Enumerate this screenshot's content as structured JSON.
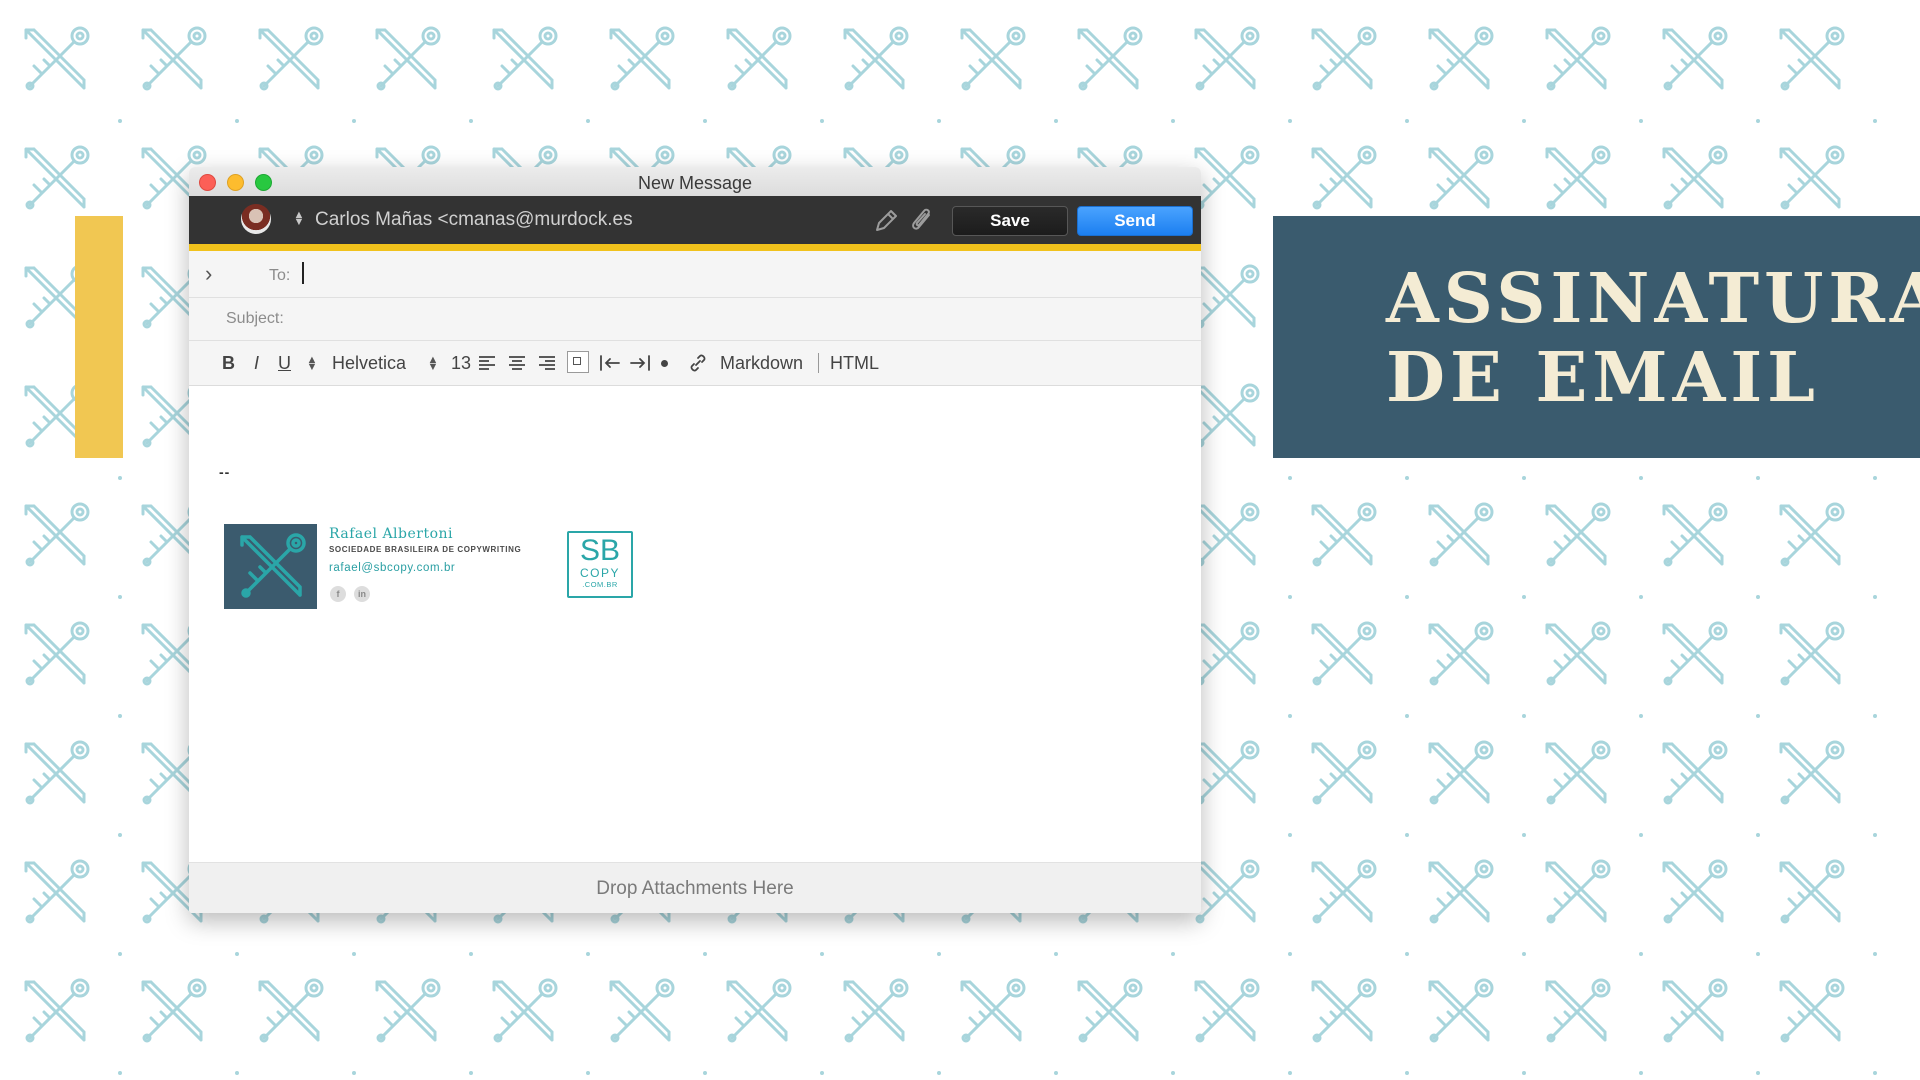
{
  "slide": {
    "title_line1": "ASSINATURA",
    "title_line2": "DE EMAIL",
    "colors": {
      "panel": "#3a5b6e",
      "title_text": "#f4ecd4",
      "accent_bar": "#f1c752",
      "pattern": "#a8d5dc"
    },
    "pattern_icon": "crossed-key-and-pencil-icon"
  },
  "window": {
    "title": "New Message"
  },
  "compose": {
    "from": "Carlos Mañas <cmanas@murdock.es",
    "save_label": "Save",
    "send_label": "Send",
    "to_label": "To:",
    "to_value": "",
    "subject_label": "Subject:",
    "subject_value": "",
    "format": {
      "bold": "B",
      "italic": "I",
      "underline": "U",
      "font": "Helvetica",
      "size": "13",
      "markdown": "Markdown",
      "html": "HTML"
    },
    "body_separator": "--",
    "attachments_label": "Drop Attachments Here"
  },
  "signature": {
    "name": "Rafael Albertoni",
    "company": "SOCIEDADE BRASILEIRA DE COPYWRITING",
    "email": "rafael@sbcopy.com.br",
    "social": [
      "f",
      "in"
    ],
    "logo_mark": "SB",
    "logo_copy": "COPY",
    "logo_domain": ".COM.BR"
  }
}
